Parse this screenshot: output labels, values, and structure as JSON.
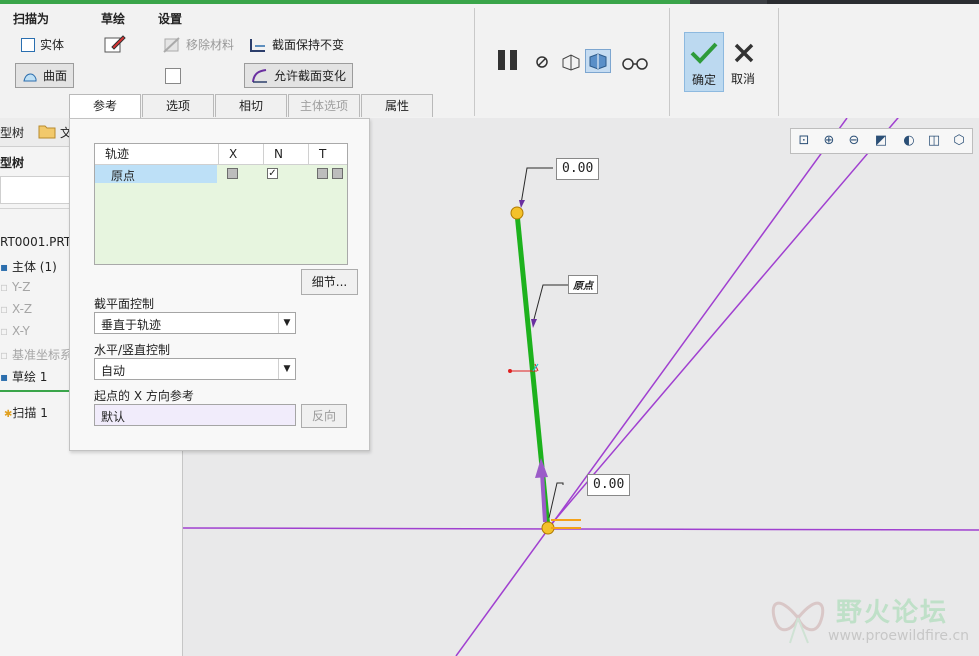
{
  "ribbon": {
    "sweep_as": {
      "title": "扫描为",
      "solid": "实体",
      "surface": "曲面"
    },
    "sketch": {
      "title": "草绘"
    },
    "settings": {
      "title": "设置",
      "remove_material": "移除材料",
      "keep_section": "截面保持不变",
      "allow_variable": "允许截面变化"
    },
    "confirm": "确定",
    "cancel": "取消"
  },
  "tabs": [
    {
      "label": "参考",
      "active": true
    },
    {
      "label": "选项"
    },
    {
      "label": "相切"
    },
    {
      "label": "主体选项",
      "disabled": true
    },
    {
      "label": "属性"
    }
  ],
  "left": {
    "tab_model_tree": "型树",
    "tab_files": "文",
    "header": "型树",
    "part": "RT0001.PRT",
    "items": [
      {
        "label": "主体 (1)"
      },
      {
        "label": "Y-Z"
      },
      {
        "label": "X-Z"
      },
      {
        "label": "X-Y"
      },
      {
        "label": "基准坐标系"
      },
      {
        "label": "草绘 1"
      },
      {
        "label": "扫描 1"
      }
    ]
  },
  "panel": {
    "table": {
      "headers": [
        "轨迹",
        "X",
        "N",
        "T"
      ],
      "row": "原点"
    },
    "details_button": "细节...",
    "section_control_label": "截平面控制",
    "section_control_value": "垂直于轨迹",
    "hv_control_label": "水平/竖直控制",
    "hv_control_value": "自动",
    "x_dir_label": "起点的 X 方向参考",
    "x_dir_value": "默认",
    "flip_button": "反向"
  },
  "viewport": {
    "dim_top": "0.00",
    "dim_bottom": "0.00",
    "origin_label": "原点"
  },
  "watermark": {
    "name": "野火论坛",
    "url": "www.proewildfire.cn"
  },
  "colors": {
    "trajectory": "#1db21d",
    "datum": "#a040d0",
    "accent": "#2c6ead",
    "point": "#f4c12a"
  }
}
